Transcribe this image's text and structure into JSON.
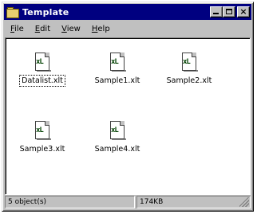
{
  "window": {
    "title": "Template",
    "icon": "folder-icon"
  },
  "title_buttons": {
    "minimize": "minimize-icon",
    "maximize": "maximize-icon",
    "close_glyph": "×"
  },
  "menu": {
    "file": {
      "accel": "F",
      "rest": "ile"
    },
    "edit": {
      "accel": "E",
      "rest": "dit"
    },
    "view": {
      "accel": "V",
      "rest": "iew"
    },
    "help": {
      "accel": "H",
      "rest": "elp"
    }
  },
  "files": [
    {
      "name": "Datalist.xlt",
      "icon": "excel-template-icon",
      "mark": "xL",
      "selected": true
    },
    {
      "name": "Sample1.xlt",
      "icon": "excel-template-icon",
      "mark": "xL",
      "selected": false
    },
    {
      "name": "Sample2.xlt",
      "icon": "excel-template-icon",
      "mark": "xL",
      "selected": false
    },
    {
      "name": "Sample3.xlt",
      "icon": "excel-template-icon",
      "mark": "xL",
      "selected": false
    },
    {
      "name": "Sample4.xlt",
      "icon": "excel-template-icon",
      "mark": "xL",
      "selected": false
    }
  ],
  "status": {
    "objects": "5 object(s)",
    "size": "174KB"
  },
  "colors": {
    "titlebar": "#000080",
    "face": "#c0c0c0"
  }
}
